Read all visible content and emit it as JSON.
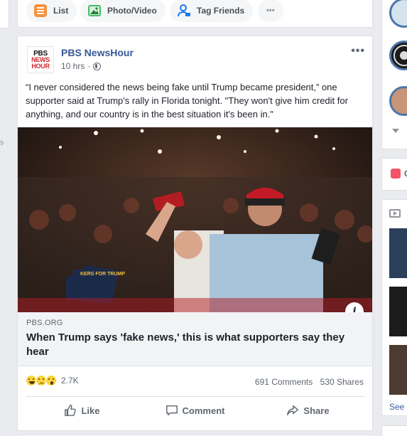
{
  "composer": {
    "list_label": "List",
    "photo_video_label": "Photo/Video",
    "tag_friends_label": "Tag Friends",
    "more_label": "•••"
  },
  "post": {
    "author": "PBS NewsHour",
    "avatar_line1": "PBS",
    "avatar_line2": "NEWS",
    "avatar_line3": "HOUR",
    "time": "10 hrs",
    "privacy_separator": "·",
    "more_label": "•••",
    "text": "“I never considered the news being fake until Trump became president,” one supporter said at Trump's rally in Florida tonight. \"They won't give him credit for anything, and our country is in the best situation it's been in.\"",
    "photo_sign_text": "KERS FOR TRUMP",
    "info_label": "i",
    "link": {
      "source": "PBS.ORG",
      "title": "When Trump says 'fake news,' this is what supporters say they hear"
    },
    "reactions": [
      "haha",
      "sad",
      "wow"
    ],
    "reaction_count": "2.7K",
    "comments": "691 Comments",
    "shares": "530 Shares",
    "actions": {
      "like": "Like",
      "comment": "Comment",
      "share": "Share"
    }
  },
  "right_column": {
    "left_number": "9",
    "gift_label": "G",
    "see_label": "See"
  },
  "colors": {
    "link_blue": "#365899",
    "background": "#e9ebee",
    "card_border": "#dddfe2",
    "pbs_red": "#d6272e"
  }
}
